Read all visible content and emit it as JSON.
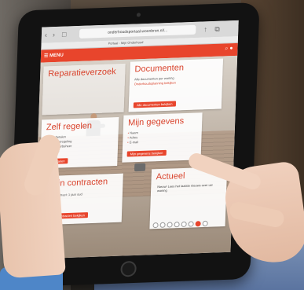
{
  "browser": {
    "url": "onderhoudsportaal.woonbron.nl/...",
    "tab_title": "Portaal - Mijn Onderhoud"
  },
  "site": {
    "menu_label": "MENU",
    "brand_color": "#e8452c"
  },
  "cards": {
    "reparatieverzoek": {
      "title": "Reparatieverzoek"
    },
    "documenten": {
      "title": "Documenten",
      "text": "Alle documenten per woning",
      "link": "Onderhoudsplanning bekijken",
      "button": "Alle documenten bekijken"
    },
    "zelf_regelen": {
      "title": "Zelf regelen",
      "items": [
        "Huur betalen",
        "Betalingsregeling",
        "Woonhuurbeheer",
        "Wijzigen"
      ],
      "button": "Zelf regelen"
    },
    "mijn_gegevens": {
      "title": "Mijn gegevens",
      "items": [
        "Naam",
        "Adres",
        "E-mail"
      ],
      "button": "Mijn gegevens bekijken"
    },
    "mijn_contracten": {
      "title": "Mijn contracten",
      "text": "Huurcontract: 1 jaar oud",
      "button": "Mijn contracten bekijken"
    },
    "actueel": {
      "title": "Actueel",
      "text": "Nieuw! Lees het laatste nieuws over uw woning"
    }
  },
  "icons": {
    "back": "chevron-left",
    "forward": "chevron-right",
    "share": "share",
    "search": "search",
    "user": "user"
  }
}
